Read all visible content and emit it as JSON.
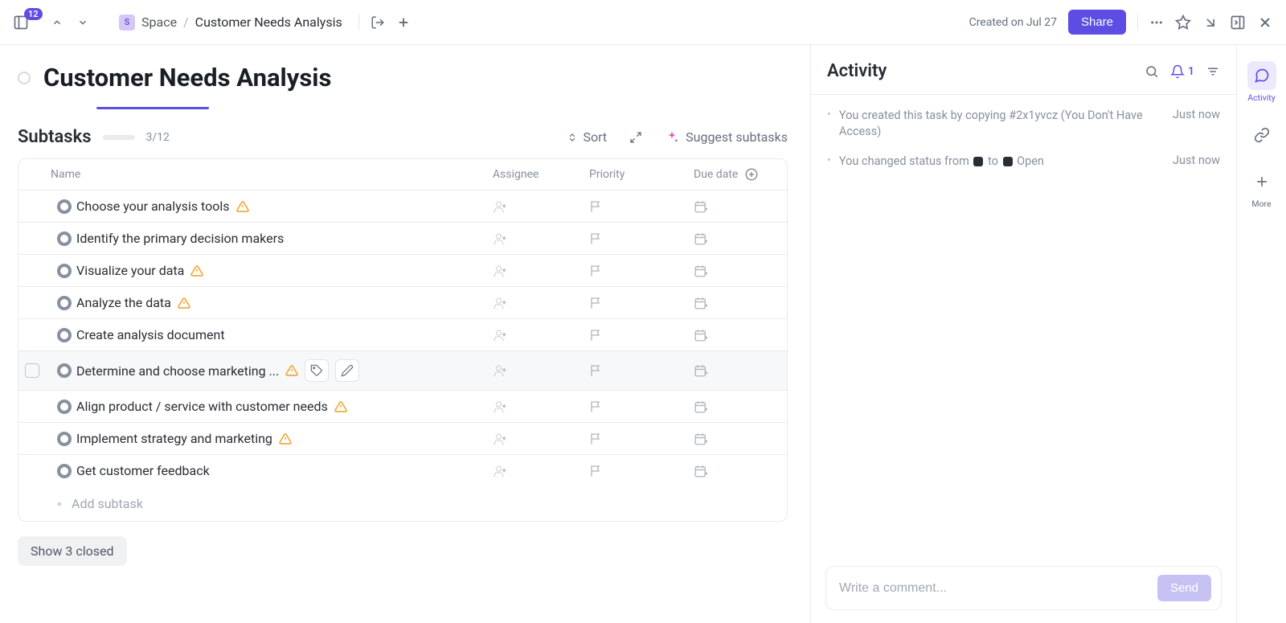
{
  "topbar": {
    "badge_count": "12",
    "space_initial": "S",
    "space_label": "Space",
    "breadcrumb_current": "Customer Needs Analysis",
    "created_on": "Created on Jul 27",
    "share_label": "Share"
  },
  "page": {
    "title": "Customer Needs Analysis"
  },
  "subtasks": {
    "heading": "Subtasks",
    "progress_text": "3/12",
    "sort_label": "Sort",
    "suggest_label": "Suggest subtasks",
    "columns": {
      "name": "Name",
      "assignee": "Assignee",
      "priority": "Priority",
      "due": "Due date"
    },
    "rows": [
      {
        "name": "Choose your analysis tools",
        "warn": true,
        "hover": false
      },
      {
        "name": "Identify the primary decision makers",
        "warn": false,
        "hover": false
      },
      {
        "name": "Visualize your data",
        "warn": true,
        "hover": false
      },
      {
        "name": "Analyze the data",
        "warn": true,
        "hover": false
      },
      {
        "name": "Create analysis document",
        "warn": false,
        "hover": false
      },
      {
        "name": "Determine and choose marketing ...",
        "warn": true,
        "hover": true
      },
      {
        "name": "Align product / service with customer needs",
        "warn": true,
        "hover": false
      },
      {
        "name": "Implement strategy and marketing",
        "warn": true,
        "hover": false
      },
      {
        "name": "Get customer feedback",
        "warn": false,
        "hover": false
      }
    ],
    "add_placeholder": "Add subtask",
    "show_closed_label": "Show 3 closed"
  },
  "activity": {
    "heading": "Activity",
    "notif_count": "1",
    "items": [
      {
        "text": "You created this task by copying #2x1yvcz (You Don't Have Access)",
        "time": "Just now",
        "status_swatches": false
      },
      {
        "text_pre": "You changed status from ",
        "text_mid": " to ",
        "text_post": " Open",
        "time": "Just now",
        "status_swatches": true
      }
    ],
    "comment_placeholder": "Write a comment...",
    "send_label": "Send"
  },
  "rail": {
    "activity_label": "Activity",
    "more_label": "More"
  }
}
